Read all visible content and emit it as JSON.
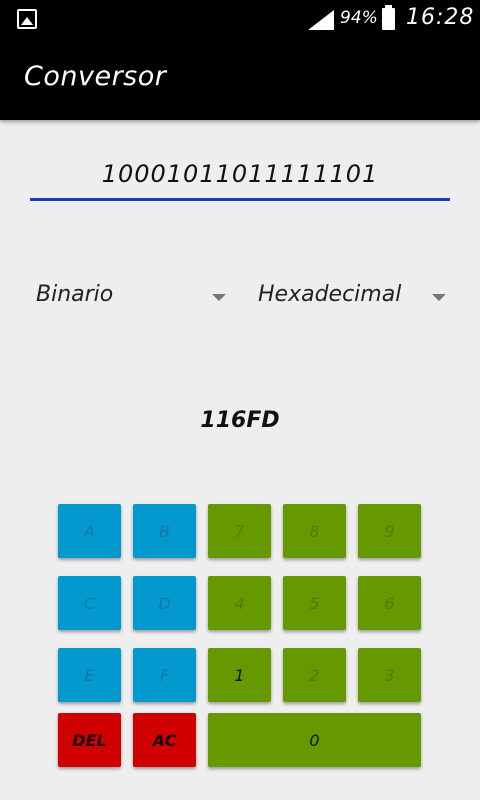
{
  "status_bar": {
    "battery_percent": "94%",
    "time": "16:28"
  },
  "app_bar": {
    "title": "Conversor"
  },
  "input": {
    "value": "10001011011111101"
  },
  "from_select": {
    "selected": "Binario"
  },
  "to_select": {
    "selected": "Hexadecimal"
  },
  "result": {
    "value": "116FD"
  },
  "keypad": {
    "keys": [
      {
        "label": "A",
        "color": "#0399cf"
      },
      {
        "label": "B",
        "color": "#0399cf"
      },
      {
        "label": "7",
        "color": "#669900"
      },
      {
        "label": "8",
        "color": "#669900"
      },
      {
        "label": "9",
        "color": "#669900"
      },
      {
        "label": "C",
        "color": "#0399cf"
      },
      {
        "label": "D",
        "color": "#0399cf"
      },
      {
        "label": "4",
        "color": "#669900"
      },
      {
        "label": "5",
        "color": "#669900"
      },
      {
        "label": "6",
        "color": "#669900"
      },
      {
        "label": "E",
        "color": "#0399cf"
      },
      {
        "label": "F",
        "color": "#0399cf"
      },
      {
        "label": "1",
        "color": "#669900"
      },
      {
        "label": "2",
        "color": "#669900"
      },
      {
        "label": "3",
        "color": "#669900"
      },
      {
        "label": "DEL",
        "color": "#d00000"
      },
      {
        "label": "AC",
        "color": "#d00000"
      },
      {
        "label": "0",
        "color": "#669900"
      }
    ]
  },
  "icons": {
    "left_status_icon": "image-icon",
    "signal_icon": "signal-icon",
    "battery_icon": "battery-icon"
  }
}
